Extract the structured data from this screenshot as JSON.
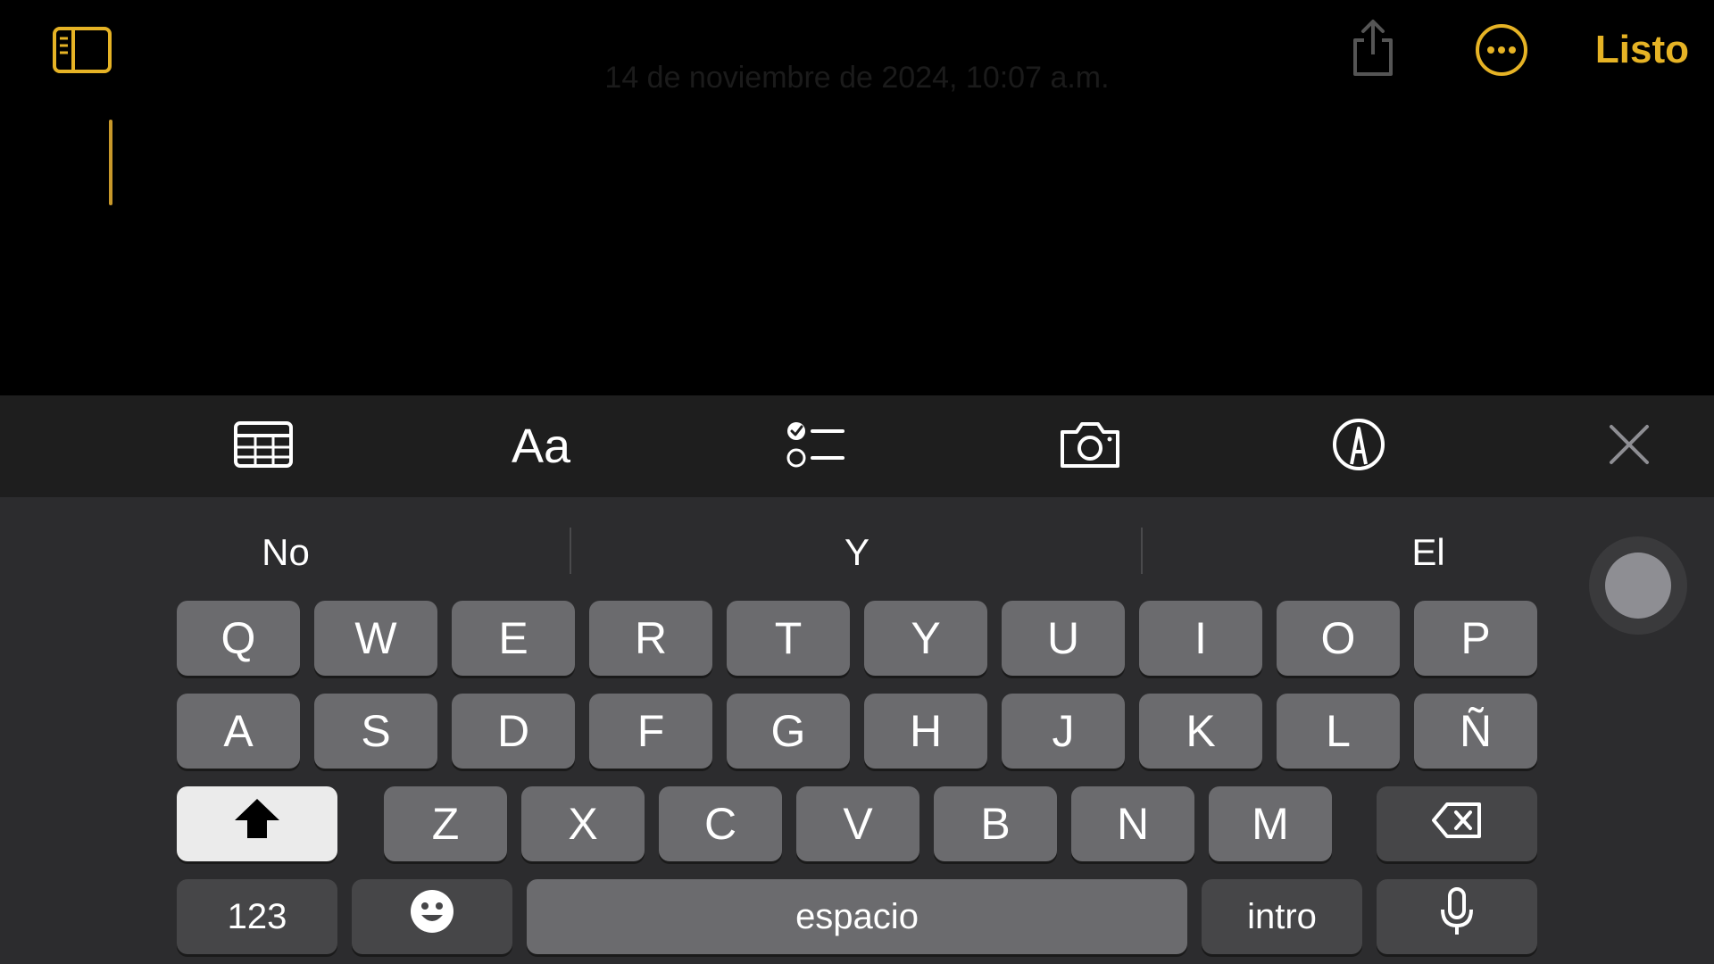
{
  "topbar": {
    "done_label": "Listo",
    "note_date": "14 de noviembre de 2024, 10:07 a.m.",
    "icons": {
      "sidebar": "sidebar-icon",
      "share": "share-icon",
      "more": "ellipsis-circle-icon"
    }
  },
  "toolbar": {
    "format_label": "Aa",
    "icons": [
      "table-icon",
      "text-format-icon",
      "checklist-icon",
      "camera-icon",
      "markup-pen-icon",
      "close-icon"
    ]
  },
  "suggestions": [
    "No",
    "Y",
    "El"
  ],
  "keyboard": {
    "row1": [
      "Q",
      "W",
      "E",
      "R",
      "T",
      "Y",
      "U",
      "I",
      "O",
      "P"
    ],
    "row2": [
      "A",
      "S",
      "D",
      "F",
      "G",
      "H",
      "J",
      "K",
      "L",
      "Ñ"
    ],
    "row3": [
      "Z",
      "X",
      "C",
      "V",
      "B",
      "N",
      "M"
    ],
    "numbers_label": "123",
    "space_label": "espacio",
    "return_label": "intro"
  },
  "colors": {
    "accent": "#e6b325",
    "background": "#000000",
    "keyboard_bg": "#2c2c2e",
    "key": "#6b6b6e",
    "key_dark": "#464648"
  }
}
